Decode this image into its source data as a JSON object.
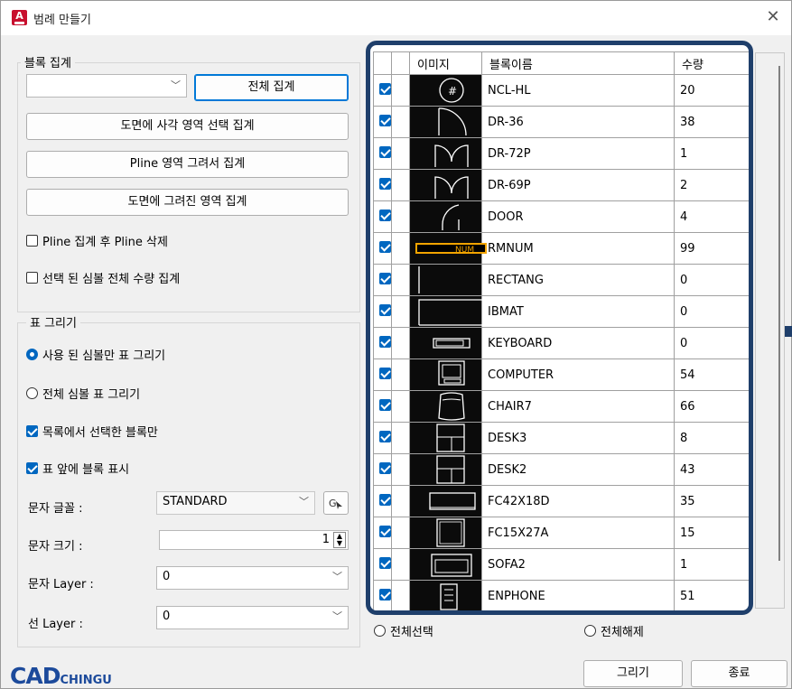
{
  "window": {
    "title": "범례 만들기",
    "close_glyph": "✕",
    "app_icon": "autocad-icon"
  },
  "block_count": {
    "legend": "블록 집계",
    "combo_value": "",
    "all_count_btn": "전체 집계",
    "rect_select_btn": "도면에 사각 영역 선택 집계",
    "pline_draw_btn": "Pline 영역 그려서 집계",
    "drawn_area_btn": "도면에 그려진 영역 집계",
    "delete_pline_cb": "Pline 집계 후 Pline 삭제",
    "delete_pline_checked": false,
    "all_qty_cb": "선택 된 심볼 전체 수량 집계",
    "all_qty_checked": false
  },
  "table_draw": {
    "legend": "표 그리기",
    "radio_used": "사용 된 심볼만 표 그리기",
    "radio_used_selected": true,
    "radio_all": "전체 심볼 표 그리기",
    "radio_all_selected": false,
    "only_selected_cb": "목록에서 선택한 블록만",
    "only_selected_checked": true,
    "show_block_cb": "표 앞에 블록 표시",
    "show_block_checked": true,
    "font_label": "문자 글꼴 :",
    "font_value": "STANDARD",
    "size_label": "문자 크기 :",
    "size_value": "1",
    "layer_label": "문자 Layer :",
    "layer_value": "0",
    "line_layer_label": "선 Layer :",
    "line_layer_value": "0"
  },
  "block_list": {
    "headers": [
      "이미지",
      "블록이름",
      "수량"
    ],
    "rows": [
      {
        "name": "NCL-HL",
        "qty": "20",
        "checked": true,
        "icon": "circle-hash"
      },
      {
        "name": "DR-36",
        "qty": "38",
        "checked": true,
        "icon": "door-swing"
      },
      {
        "name": "DR-72P",
        "qty": "1",
        "checked": true,
        "icon": "double-door"
      },
      {
        "name": "DR-69P",
        "qty": "2",
        "checked": true,
        "icon": "double-door"
      },
      {
        "name": "DOOR",
        "qty": "4",
        "checked": true,
        "icon": "door-arc"
      },
      {
        "name": "RMNUM",
        "qty": "99",
        "checked": true,
        "icon": "room-number"
      },
      {
        "name": "RECTANG",
        "qty": "0",
        "checked": true,
        "icon": "rectangle"
      },
      {
        "name": "IBMAT",
        "qty": "0",
        "checked": true,
        "icon": "mat"
      },
      {
        "name": "KEYBOARD",
        "qty": "0",
        "checked": true,
        "icon": "keyboard"
      },
      {
        "name": "COMPUTER",
        "qty": "54",
        "checked": true,
        "icon": "computer"
      },
      {
        "name": "CHAIR7",
        "qty": "66",
        "checked": true,
        "icon": "chair"
      },
      {
        "name": "DESK3",
        "qty": "8",
        "checked": true,
        "icon": "desk"
      },
      {
        "name": "DESK2",
        "qty": "43",
        "checked": true,
        "icon": "desk"
      },
      {
        "name": "FC42X18D",
        "qty": "35",
        "checked": true,
        "icon": "file-cabinet"
      },
      {
        "name": "FC15X27A",
        "qty": "15",
        "checked": true,
        "icon": "file-cabinet-tall"
      },
      {
        "name": "SOFA2",
        "qty": "1",
        "checked": true,
        "icon": "sofa"
      },
      {
        "name": "ENPHONE",
        "qty": "51",
        "checked": true,
        "icon": "phone"
      }
    ],
    "select_all": "전체선택",
    "deselect_all": "전체해제"
  },
  "footer": {
    "draw_btn": "그리기",
    "exit_btn": "종료",
    "logo_big": "CAD",
    "logo_small": "CHINGU"
  },
  "colors": {
    "accent": "#0067c0",
    "frame": "#1f3f6b",
    "logo": "#1c4a9b"
  }
}
